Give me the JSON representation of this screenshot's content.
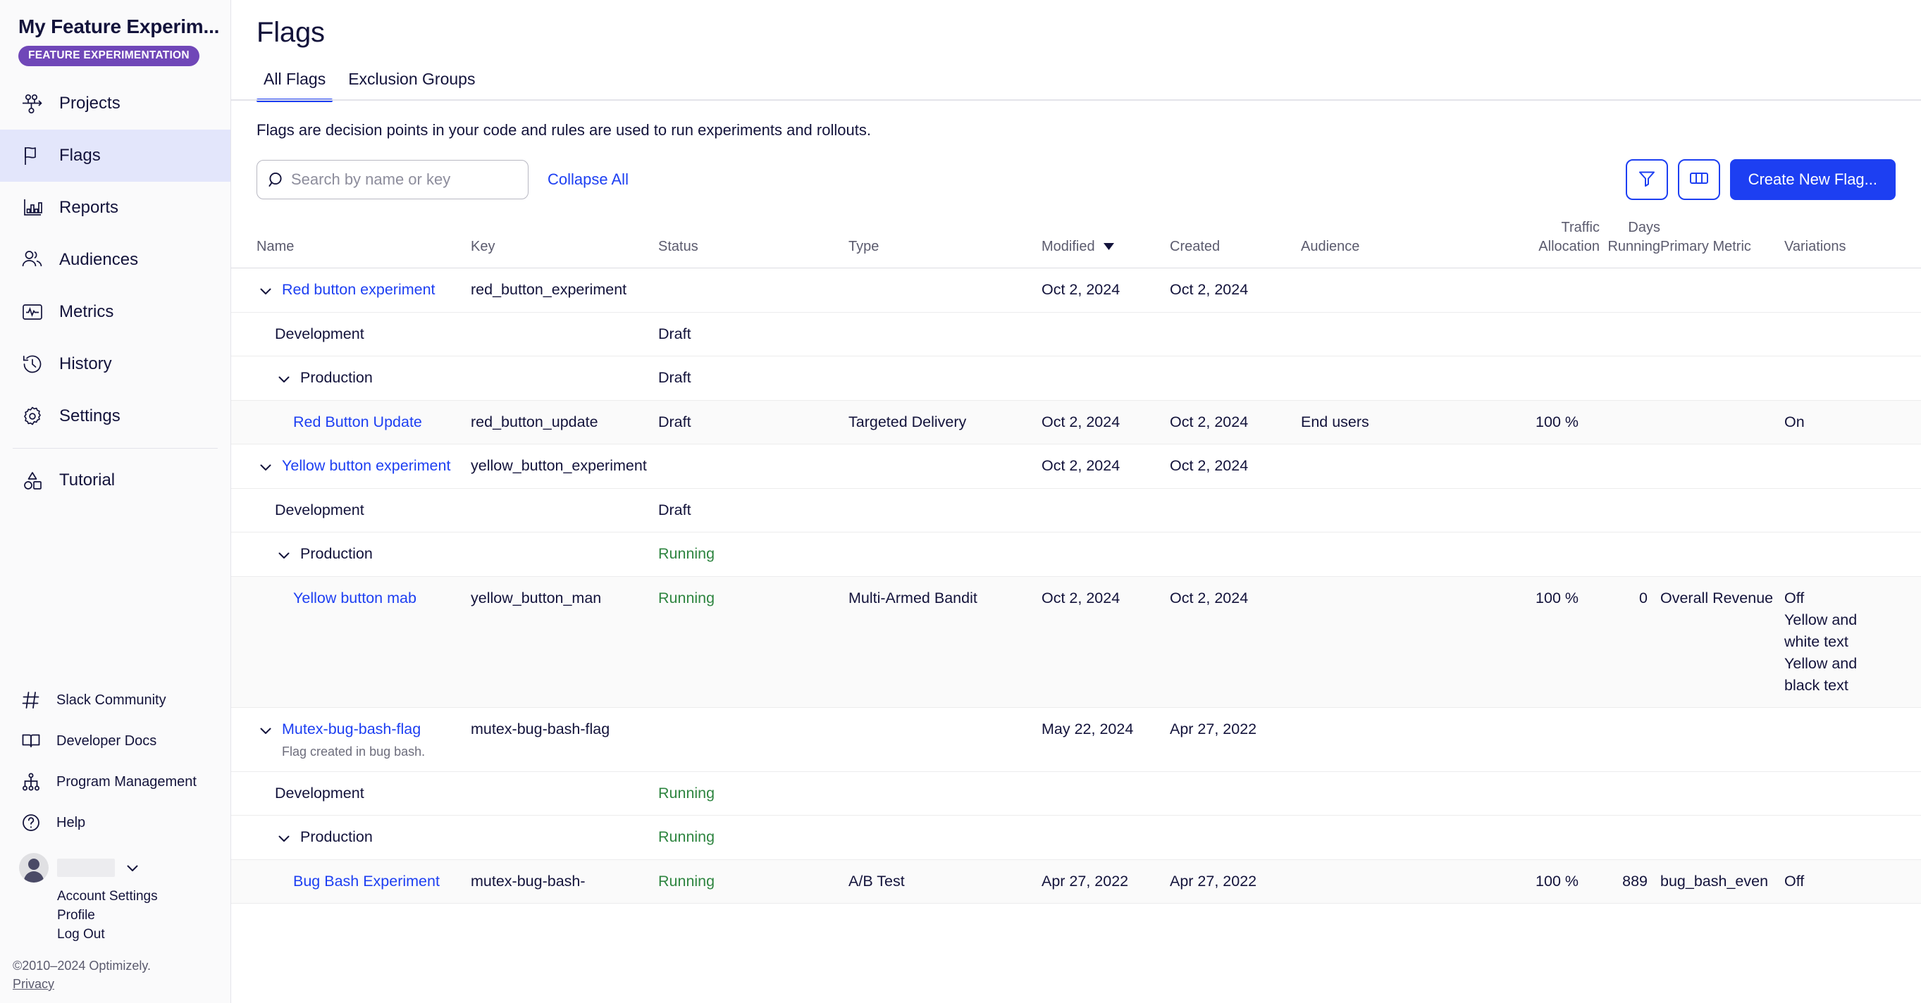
{
  "sidebar": {
    "brand_title": "My Feature Experim...",
    "brand_badge": "FEATURE EXPERIMENTATION",
    "nav": [
      {
        "label": "Projects",
        "icon": "projects-icon",
        "active": false
      },
      {
        "label": "Flags",
        "icon": "flag-icon",
        "active": true
      },
      {
        "label": "Reports",
        "icon": "reports-icon",
        "active": false
      },
      {
        "label": "Audiences",
        "icon": "audiences-icon",
        "active": false
      },
      {
        "label": "Metrics",
        "icon": "metrics-icon",
        "active": false
      },
      {
        "label": "History",
        "icon": "history-icon",
        "active": false
      },
      {
        "label": "Settings",
        "icon": "gear-icon",
        "active": false
      },
      {
        "label": "Tutorial",
        "icon": "tutorial-icon",
        "active": false
      }
    ],
    "bottom_links": [
      {
        "label": "Slack Community",
        "icon": "hash-icon"
      },
      {
        "label": "Developer Docs",
        "icon": "book-icon"
      },
      {
        "label": "Program Management",
        "icon": "org-chart-icon"
      },
      {
        "label": "Help",
        "icon": "question-circle-icon"
      }
    ],
    "account": {
      "menu": [
        "Account Settings",
        "Profile",
        "Log Out"
      ]
    },
    "copyright": "©2010–2024 Optimizely.",
    "privacy": "Privacy"
  },
  "header": {
    "title": "Flags"
  },
  "tabs": [
    {
      "label": "All Flags",
      "active": true
    },
    {
      "label": "Exclusion Groups",
      "active": false
    }
  ],
  "blurb": "Flags are decision points in your code and rules are used to run experiments and rollouts.",
  "toolbar": {
    "search_placeholder": "Search by name or key",
    "search_value": "",
    "collapse_all": "Collapse All",
    "filter_icon": "filter-icon",
    "columns_icon": "columns-icon",
    "create_label": "Create New Flag..."
  },
  "table": {
    "columns": {
      "name": "Name",
      "key": "Key",
      "status": "Status",
      "type": "Type",
      "modified": "Modified",
      "created": "Created",
      "audience": "Audience",
      "traffic_1": "Traffic",
      "traffic_2": "Allocation",
      "days_1": "Days",
      "days_2": "Running",
      "metric": "Primary Metric",
      "variations": "Variations"
    },
    "sorted_by": "modified",
    "rows": [
      {
        "kind": "flag",
        "indent": 0,
        "caret": true,
        "shaded": false,
        "name": "Red button experiment",
        "name_link": true,
        "desc": "",
        "key": "red_button_experiment",
        "status": "",
        "status_running": false,
        "type": "",
        "modified": "Oct 2, 2024",
        "created": "Oct 2, 2024",
        "audience": "",
        "traffic": "",
        "days": "",
        "metric": "",
        "variations": ""
      },
      {
        "kind": "env",
        "indent": 1,
        "caret": false,
        "shaded": false,
        "name": "Development",
        "name_link": false,
        "desc": "",
        "key": "",
        "status": "Draft",
        "status_running": false,
        "type": "",
        "modified": "",
        "created": "",
        "audience": "",
        "traffic": "",
        "days": "",
        "metric": "",
        "variations": ""
      },
      {
        "kind": "env",
        "indent": 1,
        "caret": true,
        "shaded": false,
        "name": "Production",
        "name_link": false,
        "desc": "",
        "key": "",
        "status": "Draft",
        "status_running": false,
        "type": "",
        "modified": "",
        "created": "",
        "audience": "",
        "traffic": "",
        "days": "",
        "metric": "",
        "variations": ""
      },
      {
        "kind": "rule",
        "indent": 2,
        "caret": false,
        "shaded": true,
        "name": "Red Button Update",
        "name_link": true,
        "desc": "",
        "key": "red_button_update",
        "status": "Draft",
        "status_running": false,
        "type": "Targeted Delivery",
        "modified": "Oct 2, 2024",
        "created": "Oct 2, 2024",
        "audience": "End users",
        "traffic": "100 %",
        "days": "",
        "metric": "",
        "variations": "On"
      },
      {
        "kind": "flag",
        "indent": 0,
        "caret": true,
        "shaded": false,
        "name": "Yellow button experiment",
        "name_link": true,
        "desc": "",
        "key": "yellow_button_experiment",
        "status": "",
        "status_running": false,
        "type": "",
        "modified": "Oct 2, 2024",
        "created": "Oct 2, 2024",
        "audience": "",
        "traffic": "",
        "days": "",
        "metric": "",
        "variations": ""
      },
      {
        "kind": "env",
        "indent": 1,
        "caret": false,
        "shaded": false,
        "name": "Development",
        "name_link": false,
        "desc": "",
        "key": "",
        "status": "Draft",
        "status_running": false,
        "type": "",
        "modified": "",
        "created": "",
        "audience": "",
        "traffic": "",
        "days": "",
        "metric": "",
        "variations": ""
      },
      {
        "kind": "env",
        "indent": 1,
        "caret": true,
        "shaded": false,
        "name": "Production",
        "name_link": false,
        "desc": "",
        "key": "",
        "status": "Running",
        "status_running": true,
        "type": "",
        "modified": "",
        "created": "",
        "audience": "",
        "traffic": "",
        "days": "",
        "metric": "",
        "variations": ""
      },
      {
        "kind": "rule",
        "indent": 2,
        "caret": false,
        "shaded": true,
        "name": "Yellow button mab",
        "name_link": true,
        "desc": "",
        "key": "yellow_button_man",
        "status": "Running",
        "status_running": true,
        "type": "Multi-Armed Bandit",
        "modified": "Oct 2, 2024",
        "created": "Oct 2, 2024",
        "audience": "",
        "traffic": "100 %",
        "days": "0",
        "metric": "Overall Revenue",
        "variations": "Off\nYellow and white text\nYellow and black text"
      },
      {
        "kind": "flag",
        "indent": 0,
        "caret": true,
        "shaded": false,
        "name": "Mutex-bug-bash-flag",
        "name_link": true,
        "desc": "Flag created in bug bash.",
        "key": "mutex-bug-bash-flag",
        "status": "",
        "status_running": false,
        "type": "",
        "modified": "May 22, 2024",
        "created": "Apr 27, 2022",
        "audience": "",
        "traffic": "",
        "days": "",
        "metric": "",
        "variations": ""
      },
      {
        "kind": "env",
        "indent": 1,
        "caret": false,
        "shaded": false,
        "name": "Development",
        "name_link": false,
        "desc": "",
        "key": "",
        "status": "Running",
        "status_running": true,
        "type": "",
        "modified": "",
        "created": "",
        "audience": "",
        "traffic": "",
        "days": "",
        "metric": "",
        "variations": ""
      },
      {
        "kind": "env",
        "indent": 1,
        "caret": true,
        "shaded": false,
        "name": "Production",
        "name_link": false,
        "desc": "",
        "key": "",
        "status": "Running",
        "status_running": true,
        "type": "",
        "modified": "",
        "created": "",
        "audience": "",
        "traffic": "",
        "days": "",
        "metric": "",
        "variations": ""
      },
      {
        "kind": "rule",
        "indent": 2,
        "caret": false,
        "shaded": true,
        "name": "Bug Bash Experiment",
        "name_link": true,
        "desc": "",
        "key": "mutex-bug-bash-",
        "status": "Running",
        "status_running": true,
        "type": "A/B Test",
        "modified": "Apr 27, 2022",
        "created": "Apr 27, 2022",
        "audience": "",
        "traffic": "100 %",
        "days": "889",
        "metric": "bug_bash_even",
        "variations": "Off"
      }
    ]
  },
  "colors": {
    "accent_blue": "#1d3ff2",
    "badge_purple": "#7047b8",
    "running_green": "#2e8540",
    "sidebar_active": "#e3e6fb",
    "text_dark": "#13133b"
  }
}
